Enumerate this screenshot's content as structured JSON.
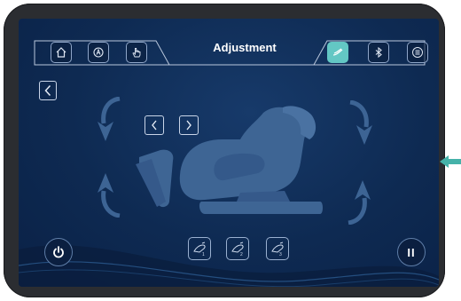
{
  "header": {
    "title": "Adjustment"
  },
  "icons": {
    "home": "home-icon",
    "auto": "auto-mode-icon",
    "manual": "hand-icon",
    "leg": "leg-rest-icon",
    "bluetooth": "bluetooth-icon",
    "menu": "list-icon",
    "back": "back-arrow-icon",
    "left": "chevron-left-icon",
    "right": "chevron-right-icon",
    "power": "power-icon",
    "pause": "pause-icon"
  },
  "controls": {
    "pause_label": "II"
  },
  "colors": {
    "screen_bg": "#0e2a52",
    "accent": "#63c7c4",
    "chair": "#3e6594",
    "arrow_indicator": "#45b2a9"
  }
}
